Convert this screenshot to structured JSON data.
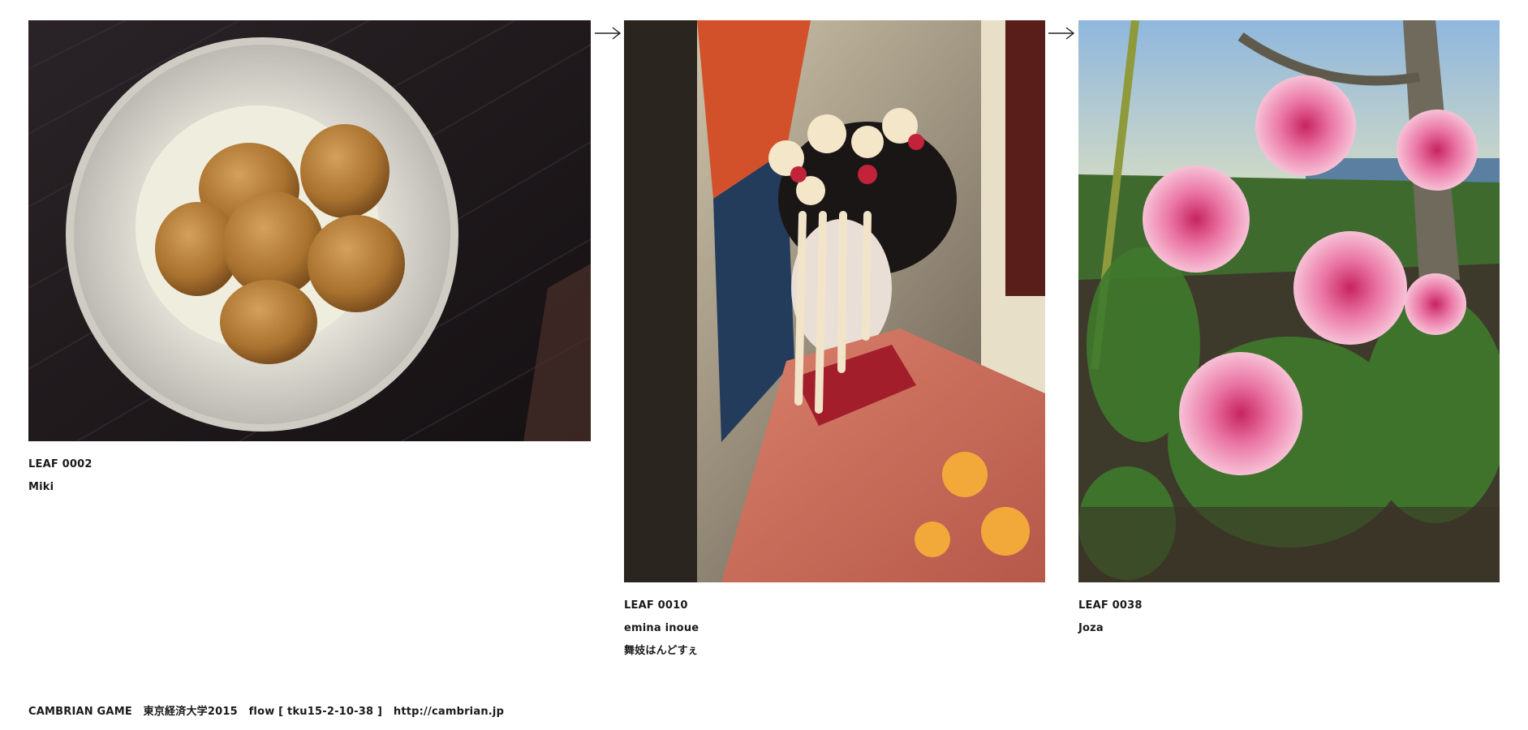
{
  "leaves": [
    {
      "id_label": "LEAF 0002",
      "author": "Miki",
      "photo_icon": "bowl-of-simmered-taro-image"
    },
    {
      "id_label": "LEAF 0010",
      "author": "emina inoue",
      "title": "舞妓はんどすぇ",
      "photo_icon": "maiko-kimono-portrait-image"
    },
    {
      "id_label": "LEAF 0038",
      "author": "Joza",
      "photo_icon": "pink-peony-flowers-image"
    }
  ],
  "arrow_icon": "right-arrow-icon",
  "footer": {
    "game": "CAMBRIAN GAME",
    "event": "東京経済大学2015",
    "flow": "flow [ tku15-2-10-38 ]",
    "url": "http://cambrian.jp"
  },
  "colors": {
    "background": "#ffffff",
    "text": "#1a1a1a"
  }
}
